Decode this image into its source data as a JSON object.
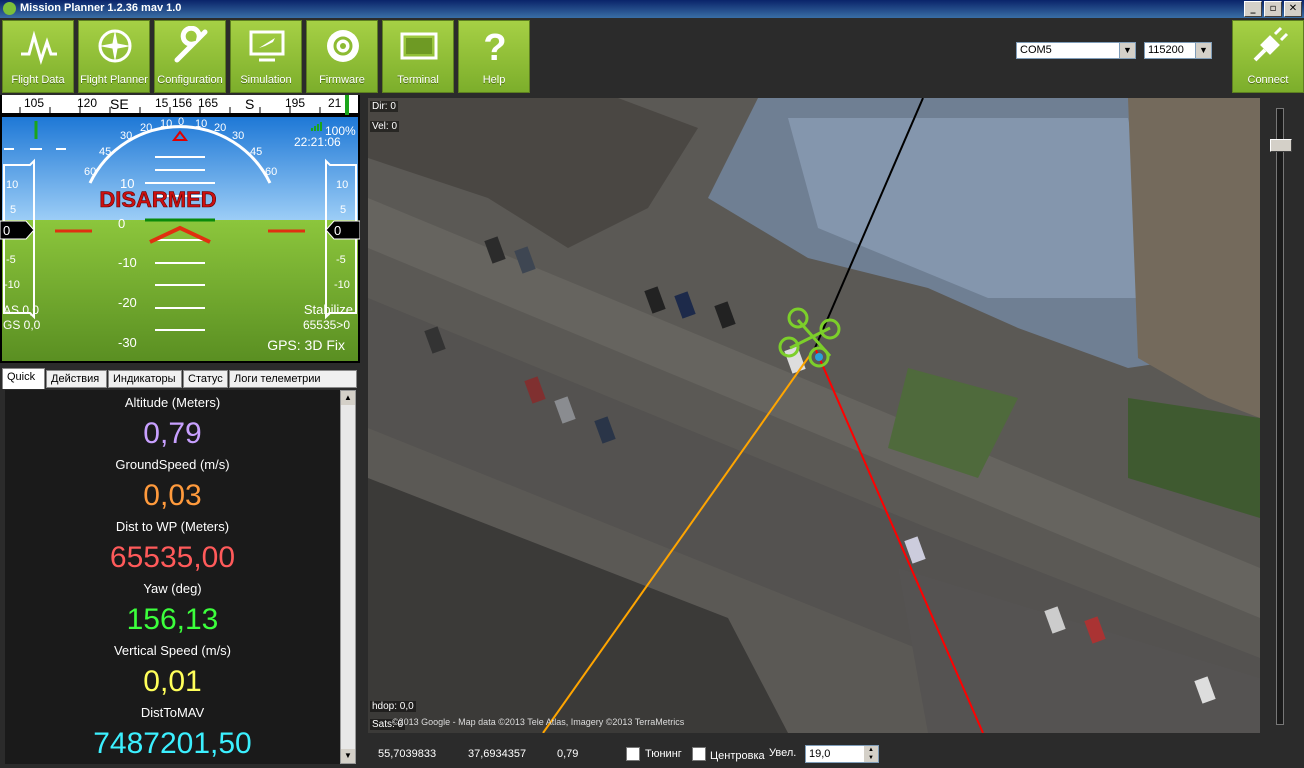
{
  "window": {
    "title": "Mission Planner 1.2.36 mav 1.0"
  },
  "toolbar": {
    "buttons": [
      {
        "label": "Flight Data",
        "icon": "pulse-icon"
      },
      {
        "label": "Flight Planner",
        "icon": "compass-icon"
      },
      {
        "label": "Configuration",
        "icon": "wrench-icon"
      },
      {
        "label": "Simulation",
        "icon": "monitor-plane-icon"
      },
      {
        "label": "Firmware",
        "icon": "disc-icon"
      },
      {
        "label": "Terminal",
        "icon": "terminal-icon"
      },
      {
        "label": "Help",
        "icon": "help-icon"
      }
    ],
    "connect_label": "Connect",
    "port": "COM5",
    "baud": "115200"
  },
  "hud": {
    "heading_ticks": [
      "105",
      "120",
      "SE",
      "15",
      "156",
      "165",
      "S",
      "195",
      "21"
    ],
    "pitch_marks": [
      "10",
      "0",
      "-10",
      "-20",
      "-30"
    ],
    "roll_marks": [
      "60",
      "45",
      "30",
      "20",
      "10",
      "0",
      "10",
      "20",
      "30",
      "45",
      "60"
    ],
    "left_scale": [
      "10",
      "5",
      "-5",
      "-10"
    ],
    "right_scale": [
      "10",
      "5",
      "-5",
      "-10"
    ],
    "left_value": "0",
    "right_value": "0",
    "armed_text": "DISARMED",
    "battery": "100%",
    "time": "22:21:06",
    "airspeed": "AS 0,0",
    "groundspeed": "GS 0,0",
    "mode": "Stabilize",
    "wp": "65535>0",
    "gps": "GPS: 3D Fix"
  },
  "tabs": [
    "Quick",
    "Действия",
    "Индикаторы",
    "Статус",
    "Логи телеметрии"
  ],
  "quick": [
    {
      "label": "Altitude (Meters)",
      "value": "0,79",
      "color": "#c8a0ff"
    },
    {
      "label": "GroundSpeed (m/s)",
      "value": "0,03",
      "color": "#ff9a3c"
    },
    {
      "label": "Dist to WP (Meters)",
      "value": "65535,00",
      "color": "#ff5a5a"
    },
    {
      "label": "Yaw (deg)",
      "value": "156,13",
      "color": "#3cff3c"
    },
    {
      "label": "Vertical Speed (m/s)",
      "value": "0,01",
      "color": "#ffff5a"
    },
    {
      "label": "DistToMAV",
      "value": "7487201,50",
      "color": "#3cf0ff"
    }
  ],
  "map": {
    "dir": "Dir: 0",
    "vel": "Vel: 0",
    "hdop": "hdop: 0,0",
    "sats": "Sats: 0",
    "attribution": "©2013 Google - Map data ©2013 Tele Atlas, Imagery ©2013 TerraMetrics"
  },
  "status": {
    "lat": "55,7039833",
    "lng": "37,6934357",
    "alt": "0,79",
    "tuning_label": "Тюнинг",
    "center_label": "Центровка",
    "zoom_label": "Увел.",
    "zoom_value": "19,0"
  }
}
